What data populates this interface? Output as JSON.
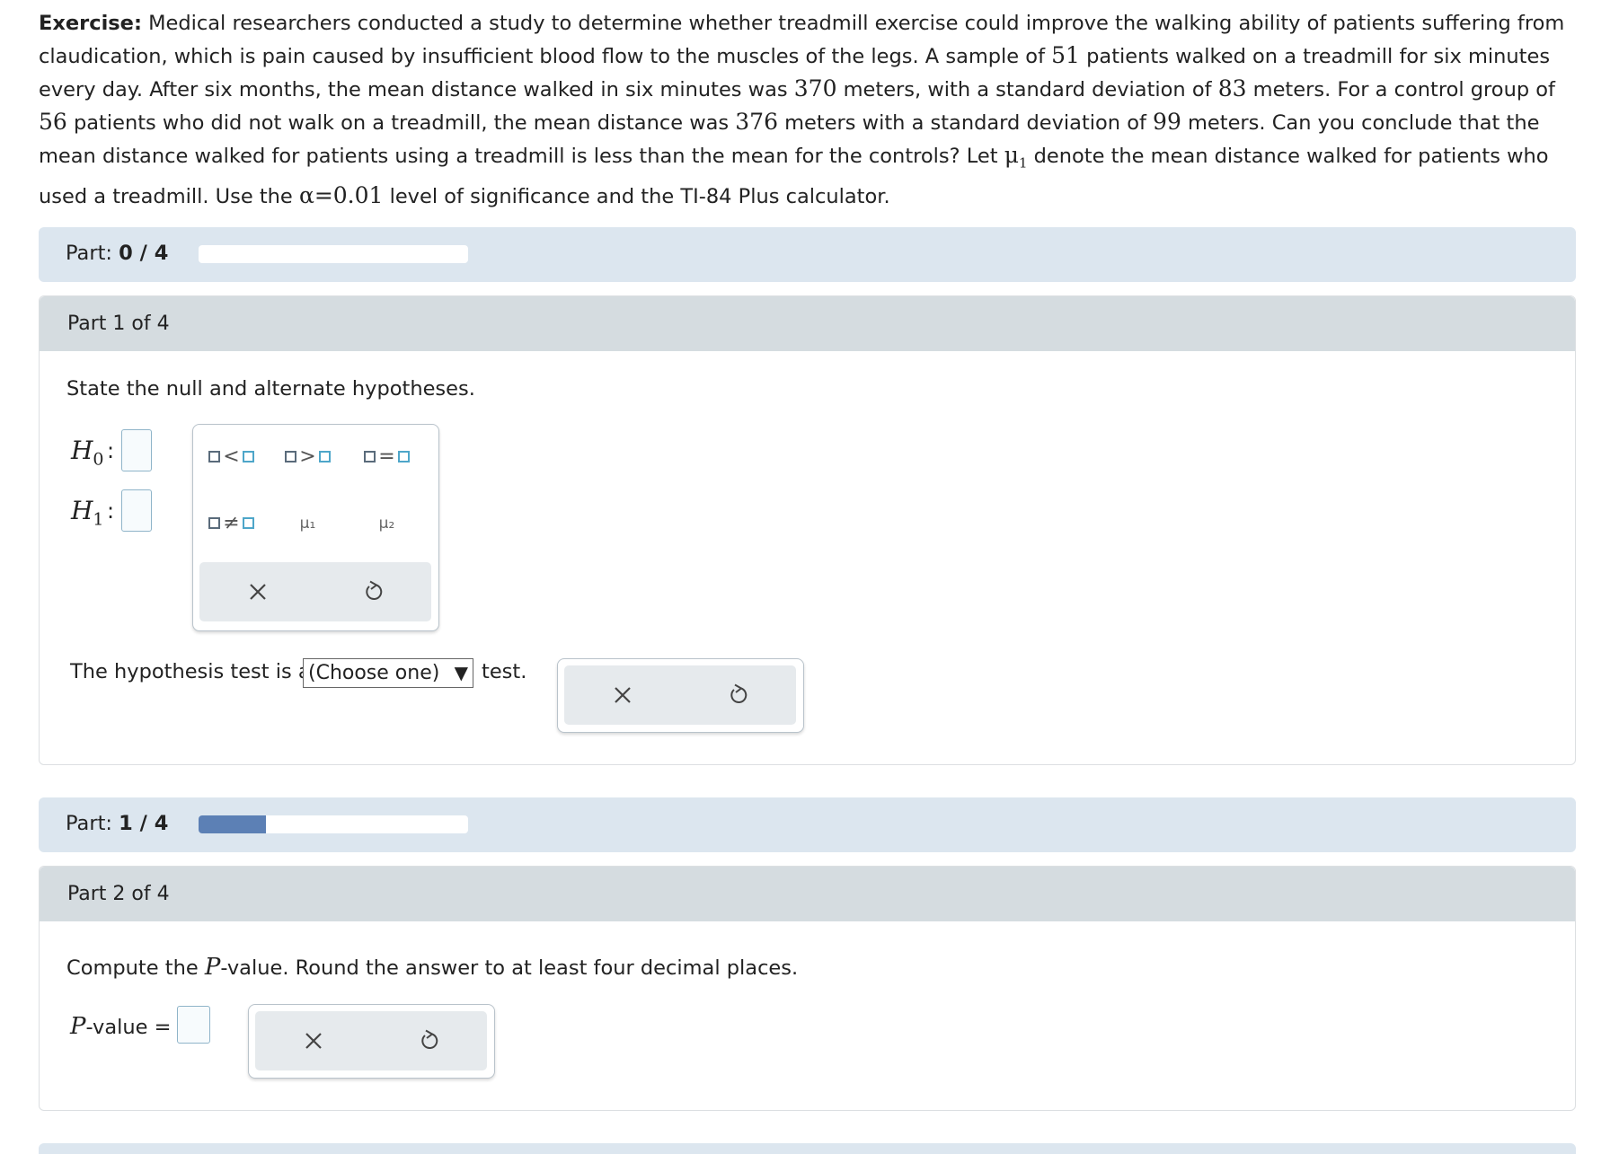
{
  "exercise": {
    "lead": "Exercise:",
    "s1": " Medical researchers conducted a study to determine whether treadmill exercise could improve the walking ability of patients suffering from claudication, which is pain caused by insufficient blood flow to the muscles of the legs. A sample of ",
    "n1": "51",
    "s2": " patients walked on a treadmill for six minutes every day. After six months, the mean distance walked in six minutes was ",
    "mean1": "370",
    "s3": " meters, with a standard deviation of ",
    "sd1": "83",
    "s4": " meters. For a control group of ",
    "n2": "56",
    "s5": " patients who did not walk on a treadmill, the mean distance was ",
    "mean2": "376",
    "s6": " meters with a standard deviation of ",
    "sd2": "99",
    "s7": " meters. Can you conclude that the mean distance walked for patients using a treadmill is less than the mean for the controls? Let ",
    "mu": "μ",
    "mu_sub": "1",
    "s8": " denote the mean distance walked for patients who used a treadmill. Use the ",
    "alpha": "α=0.01",
    "s9": " level of significance and the TI-84 Plus calculator."
  },
  "progress1": {
    "label": "Part:",
    "value": "0 / 4",
    "fraction": 0.0
  },
  "part1": {
    "header": "Part 1 of 4",
    "prompt": "State the null and alternate hypotheses.",
    "h0": {
      "letter": "H",
      "sub": "0",
      "colon": ":"
    },
    "h1": {
      "letter": "H",
      "sub": "1",
      "colon": ":"
    },
    "palette": {
      "lt": "<",
      "gt": ">",
      "eq": "=",
      "ne": "≠",
      "mu1": "μ₁",
      "mu2": "μ₂"
    },
    "test_prefix": "The hypothesis test is a",
    "test_select": "(Choose one)",
    "test_arrow": "▼",
    "test_suffix": "test."
  },
  "progress2": {
    "label": "Part:",
    "value": "1 / 4",
    "fraction": 0.25
  },
  "part2": {
    "header": "Part 2 of 4",
    "prompt_pre": "Compute the ",
    "prompt_p": "P",
    "prompt_post": "-value. Round the answer to at least four decimal places.",
    "pvalue_p": "P",
    "pvalue_label": "-value ="
  },
  "colors": {
    "progress_band": "#dce6ef",
    "progress_fill": "#5c80b5",
    "part_header": "#d5dce0",
    "action_bar": "#e6eaed",
    "answer_box_border": "#8fb4c9"
  },
  "icons": [
    "clear-x-icon",
    "undo-icon",
    "dropdown-arrow-icon"
  ]
}
